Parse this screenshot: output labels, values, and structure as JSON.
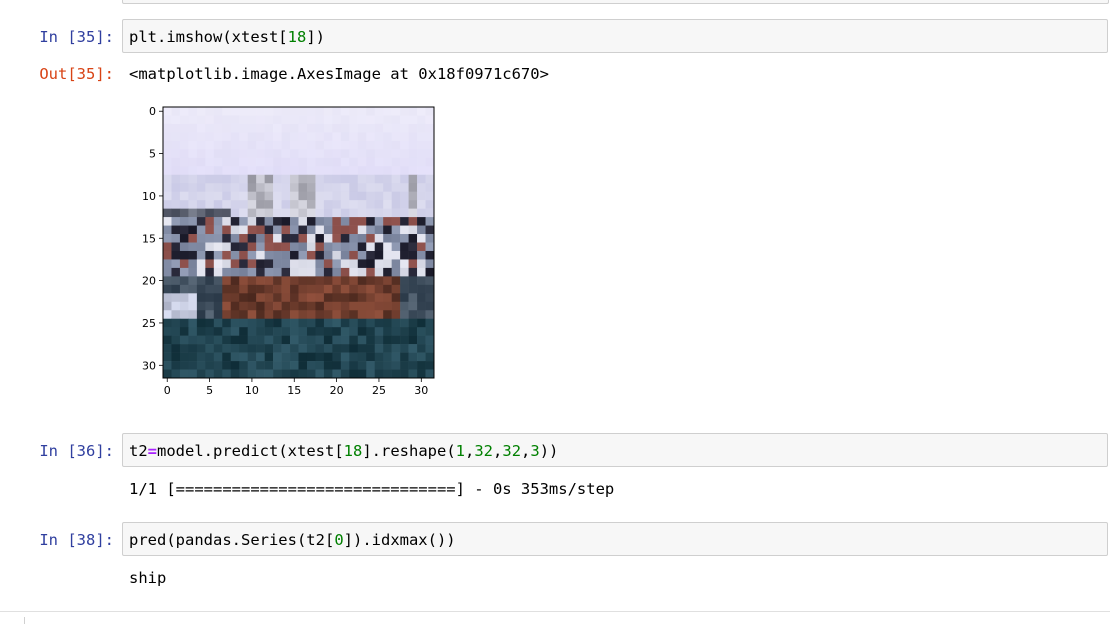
{
  "cells": [
    {
      "prompt": "In [35]:",
      "code": "plt.imshow(xtest[18])",
      "code_tokens": [
        {
          "t": "plt.imshow(xtest[",
          "c": "fn"
        },
        {
          "t": "18",
          "c": "num"
        },
        {
          "t": "])",
          "c": "fn"
        }
      ],
      "out_prompt": "Out[35]:",
      "output_text": "<matplotlib.image.AxesImage at 0x18f0971c670>"
    },
    {
      "prompt": "In [36]:",
      "code": "t2=model.predict(xtest[18].reshape(1,32,32,3))",
      "code_tokens": [
        {
          "t": "t2",
          "c": "fn"
        },
        {
          "t": "=",
          "c": "op"
        },
        {
          "t": "model.predict(xtest[",
          "c": "fn"
        },
        {
          "t": "18",
          "c": "num"
        },
        {
          "t": "].reshape(",
          "c": "fn"
        },
        {
          "t": "1",
          "c": "num"
        },
        {
          "t": ",",
          "c": "fn"
        },
        {
          "t": "32",
          "c": "num"
        },
        {
          "t": ",",
          "c": "fn"
        },
        {
          "t": "32",
          "c": "num"
        },
        {
          "t": ",",
          "c": "fn"
        },
        {
          "t": "3",
          "c": "num"
        },
        {
          "t": "))",
          "c": "fn"
        }
      ],
      "output_text": "1/1 [==============================] - 0s 353ms/step"
    },
    {
      "prompt": "In [38]:",
      "code": "pred(pandas.Series(t2[0]).idxmax())",
      "code_tokens": [
        {
          "t": "pred(pandas.Series(t2[",
          "c": "fn"
        },
        {
          "t": "0",
          "c": "num"
        },
        {
          "t": "]).idxmax())",
          "c": "fn"
        }
      ],
      "output_text": "ship"
    }
  ],
  "plot": {
    "x_ticks": [
      "0",
      "5",
      "10",
      "15",
      "20",
      "25",
      "30"
    ],
    "y_ticks": [
      "0",
      "5",
      "10",
      "15",
      "20",
      "25",
      "30"
    ],
    "tick_values": [
      0,
      5,
      10,
      15,
      20,
      25,
      30
    ],
    "grid_size": 32
  },
  "colors": {
    "in_prompt": "#303f9f",
    "out_prompt": "#d84315",
    "number": "#008000",
    "operator": "#aa22ff",
    "cell_bg": "#f7f7f7",
    "cell_border": "#cfcfcf"
  }
}
